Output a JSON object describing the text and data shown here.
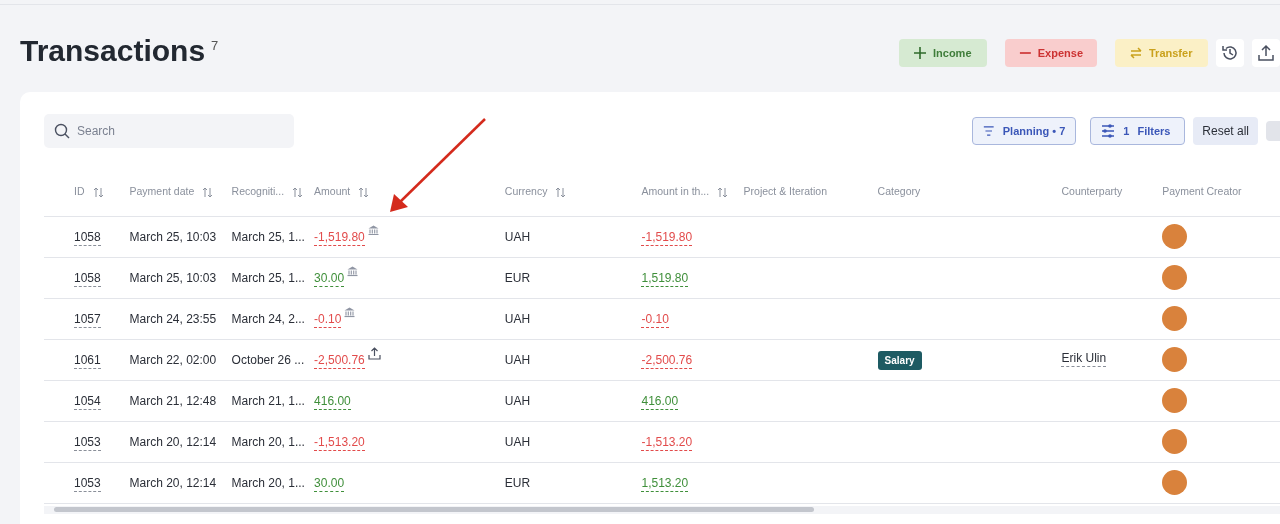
{
  "page": {
    "title": "Transactions",
    "count": "7"
  },
  "actions": [
    {
      "kind": "income",
      "label": "Income"
    },
    {
      "kind": "expense",
      "label": "Expense"
    },
    {
      "kind": "transfer",
      "label": "Transfer"
    }
  ],
  "toolbar": {
    "search_placeholder": "Search",
    "planning": "Planning • 7",
    "filters_count": "1",
    "filters": "Filters",
    "reset": "Reset all"
  },
  "table": {
    "columns": [
      {
        "label": "ID",
        "sortable": true
      },
      {
        "label": "Payment date",
        "sortable": true
      },
      {
        "label": "Recogniti...",
        "sortable": true
      },
      {
        "label": "Amount",
        "sortable": true
      },
      {
        "label": "Currency",
        "sortable": true
      },
      {
        "label": "Amount in th...",
        "sortable": true
      },
      {
        "label": "Project & Iteration",
        "sortable": false
      },
      {
        "label": "Category",
        "sortable": false
      },
      {
        "label": "Counterparty",
        "sortable": false
      },
      {
        "label": "Payment Creator",
        "sortable": false
      }
    ],
    "rows": [
      {
        "id": "1058",
        "payment_date": "March 25, 10:03",
        "recognition": "March 25, 1...",
        "amount": "-1,519.80",
        "negative": true,
        "bank_linked": true,
        "uploaded": false,
        "currency": "UAH",
        "amount_converted": "-1,519.80"
      },
      {
        "id": "1058",
        "payment_date": "March 25, 10:03",
        "recognition": "March 25, 1...",
        "amount": "30.00",
        "negative": false,
        "bank_linked": true,
        "uploaded": false,
        "currency": "EUR",
        "amount_converted": "1,519.80"
      },
      {
        "id": "1057",
        "payment_date": "March 24, 23:55",
        "recognition": "March 24, 2...",
        "amount": "-0.10",
        "negative": true,
        "bank_linked": true,
        "uploaded": false,
        "currency": "UAH",
        "amount_converted": "-0.10"
      },
      {
        "id": "1061",
        "payment_date": "March 22, 02:00",
        "recognition": "October 26 ...",
        "amount": "-2,500.76",
        "negative": true,
        "bank_linked": false,
        "uploaded": true,
        "currency": "UAH",
        "amount_converted": "-2,500.76",
        "category": "Salary",
        "counterparty": "Erik Ulin"
      },
      {
        "id": "1054",
        "payment_date": "March 21, 12:48",
        "recognition": "March 21, 1...",
        "amount": "416.00",
        "negative": false,
        "bank_linked": false,
        "uploaded": false,
        "currency": "UAH",
        "amount_converted": "416.00"
      },
      {
        "id": "1053",
        "payment_date": "March 20, 12:14",
        "recognition": "March 20, 1...",
        "amount": "-1,513.20",
        "negative": true,
        "bank_linked": false,
        "uploaded": false,
        "currency": "UAH",
        "amount_converted": "-1,513.20"
      },
      {
        "id": "1053",
        "payment_date": "March 20, 12:14",
        "recognition": "March 20, 1...",
        "amount": "30.00",
        "negative": false,
        "bank_linked": false,
        "uploaded": false,
        "currency": "EUR",
        "amount_converted": "1,513.20"
      }
    ]
  }
}
